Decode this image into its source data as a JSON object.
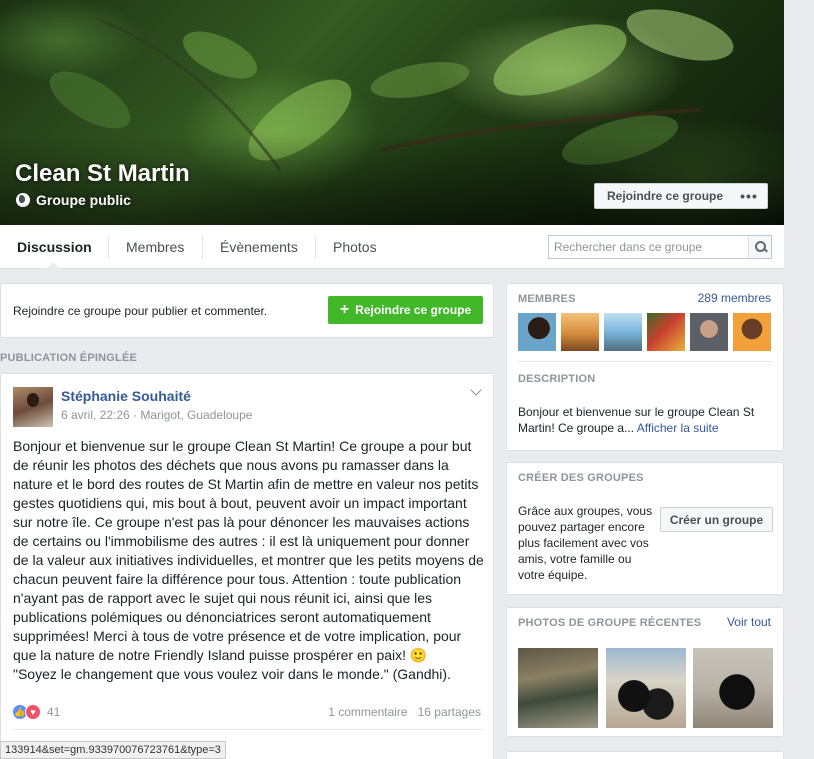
{
  "cover": {
    "group_name": "Clean St Martin",
    "group_type": "Groupe public",
    "join_button": "Rejoindre ce groupe",
    "more_button": "•••"
  },
  "tabs": [
    {
      "label": "Discussion",
      "active": true
    },
    {
      "label": "Membres",
      "active": false
    },
    {
      "label": "Évènements",
      "active": false
    },
    {
      "label": "Photos",
      "active": false
    }
  ],
  "search": {
    "placeholder": "Rechercher dans ce groupe"
  },
  "join_card": {
    "text": "Rejoindre ce groupe pour publier et commenter.",
    "button": "Rejoindre ce groupe"
  },
  "pinned_label": "PUBLICATION ÉPINGLÉE",
  "post": {
    "author": "Stéphanie Souhaité",
    "meta": "6 avril, 22:26 · Marigot, Guadeloupe",
    "body": "Bonjour et bienvenue sur le groupe Clean St Martin! Ce groupe a pour but de réunir les photos des déchets que nous avons pu ramasser dans la nature et le bord des routes de St Martin afin de mettre en valeur nos petits gestes quotidiens qui, mis bout à bout, peuvent avoir un impact important sur notre île. Ce groupe n'est pas là pour dénoncer les mauvaises actions de certains ou l'immobilisme des autres : il est là uniquement pour donner de la valeur aux initiatives individuelles, et montrer que les petits moyens de chacun peuvent faire la différence pour tous. Attention : toute publication n'ayant pas de rapport avec le sujet qui nous réunit ici, ainsi que les publications polémiques ou dénonciatrices seront automatiquement supprimées! Merci à tous de votre présence et de votre implication, pour que la nature de notre Friendly Island puisse prospérer en paix! 🙂",
    "quote": "\"Soyez le changement que vous voulez voir dans le monde.\" (Gandhi).",
    "reaction_count": "41",
    "comments": "1 commentaire",
    "shares": "16 partages"
  },
  "sidebar": {
    "members_title": "MEMBRES",
    "members_count": "289 membres",
    "description_title": "DESCRIPTION",
    "description_text": "Bonjour et bienvenue sur le groupe Clean St Martin! Ce groupe a...",
    "description_more": "Afficher la suite",
    "create_title": "CRÉER DES GROUPES",
    "create_text": "Grâce aux groupes, vous pouvez partager encore plus facilement avec vos amis, votre famille ou votre équipe.",
    "create_button": "Créer un groupe",
    "photos_title": "PHOTOS DE GROUPE RÉCENTES",
    "photos_link": "Voir tout"
  },
  "status_url": "133914&set=gm.933970076723761&type=3",
  "colors": {
    "link": "#365899",
    "join_green": "#42b72a",
    "background": "#e9ebee"
  }
}
